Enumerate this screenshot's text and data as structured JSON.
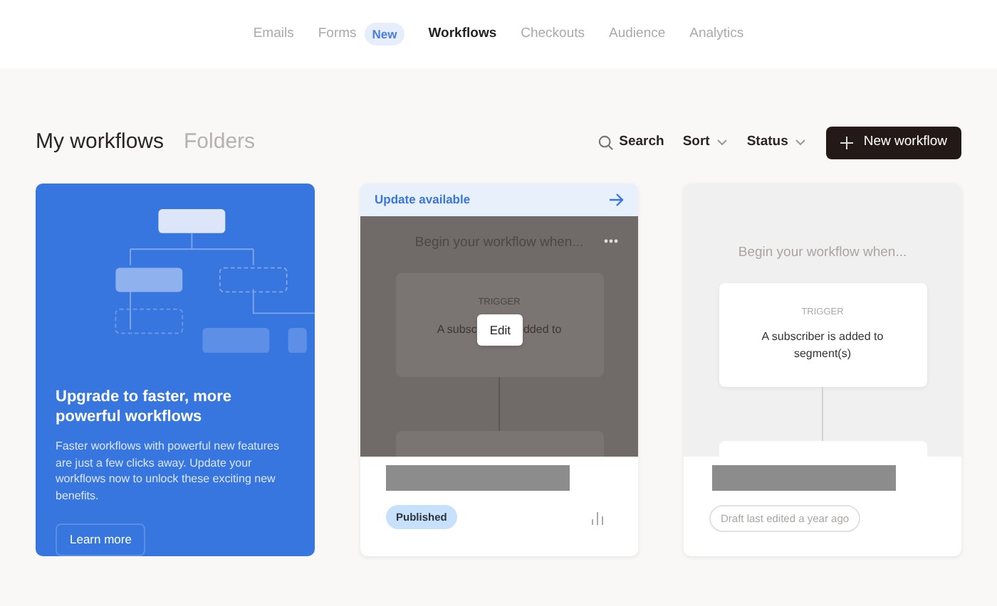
{
  "nav": [
    {
      "label": "Emails",
      "selected": false
    },
    {
      "label": "Forms",
      "selected": false,
      "badge": "New"
    },
    {
      "label": "Workflows",
      "selected": true
    },
    {
      "label": "Checkouts",
      "selected": false
    },
    {
      "label": "Audience",
      "selected": false
    },
    {
      "label": "Analytics",
      "selected": false
    }
  ],
  "views": [
    {
      "label": "My workflows",
      "selected": true
    },
    {
      "label": "Folders",
      "selected": false
    }
  ],
  "toolbar": {
    "search": "Search",
    "sort": "Sort",
    "status": "Status",
    "new_button": "New workflow"
  },
  "promo": {
    "title": "Upgrade to faster, more powerful workflows",
    "body": "Faster workflows with powerful new features are just a few clicks away. Update your workflows now to unlock these exciting new benefits.",
    "button": "Learn more"
  },
  "workflows": [
    {
      "banner": "Update available",
      "hovered": true,
      "heading": "Begin your workflow when...",
      "trigger_label": "TRIGGER",
      "trigger_text_parts": [
        "A subsc",
        "dded to"
      ],
      "edit_button": "Edit",
      "status": "Published",
      "kind": "published"
    },
    {
      "hovered": false,
      "heading": "Begin your workflow when...",
      "trigger_label": "TRIGGER",
      "trigger_text": "A subscriber is added to segment(s)",
      "status": "Draft last edited a year ago",
      "kind": "draft"
    }
  ]
}
